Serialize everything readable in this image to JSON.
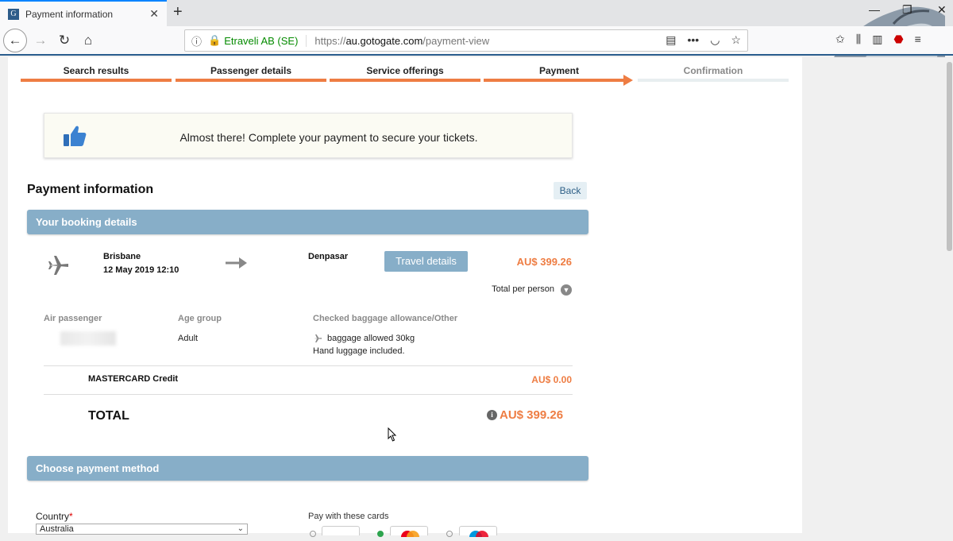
{
  "browser": {
    "tab_title": "Payment information",
    "tab_favicon": "G",
    "url_org": "Etraveli AB (SE)",
    "url_proto": "https://",
    "url_domain": "au.gotogate.com",
    "url_path": "/payment-view"
  },
  "steps": [
    {
      "label": "Search results",
      "state": "done"
    },
    {
      "label": "Passenger details",
      "state": "done"
    },
    {
      "label": "Service offerings",
      "state": "done"
    },
    {
      "label": "Payment",
      "state": "active"
    },
    {
      "label": "Confirmation",
      "state": "future"
    }
  ],
  "notice": {
    "message": "Almost there! Complete your payment to secure your tickets."
  },
  "payment_info": {
    "title": "Payment information",
    "back_label": "Back"
  },
  "booking": {
    "header": "Your booking details",
    "origin_city": "Brisbane",
    "origin_datetime": "12 May 2019 12:10",
    "dest_city": "Denpasar",
    "travel_details_label": "Travel details",
    "price_per_person": "AU$ 399.26",
    "total_per_person_label": "Total per person",
    "columns": {
      "passenger": "Air passenger",
      "age_group": "Age group",
      "baggage": "Checked baggage allowance/Other"
    },
    "passenger": {
      "age_group": "Adult",
      "baggage_line1": "baggage allowed 30kg",
      "baggage_line2": "Hand luggage included."
    },
    "card_fee_label": "MASTERCARD Credit",
    "card_fee": "AU$ 0.00",
    "total_label": "TOTAL",
    "total_price": "AU$ 399.26"
  },
  "payment_method": {
    "header": "Choose payment method",
    "country_label": "Country",
    "country_required": "*",
    "country_value": "Australia",
    "cards_label": "Pay with these cards"
  },
  "colors": {
    "accent_orange": "#ee7d43",
    "section_blue": "#87aec8",
    "chrome_blue": "#2a5d8d"
  }
}
